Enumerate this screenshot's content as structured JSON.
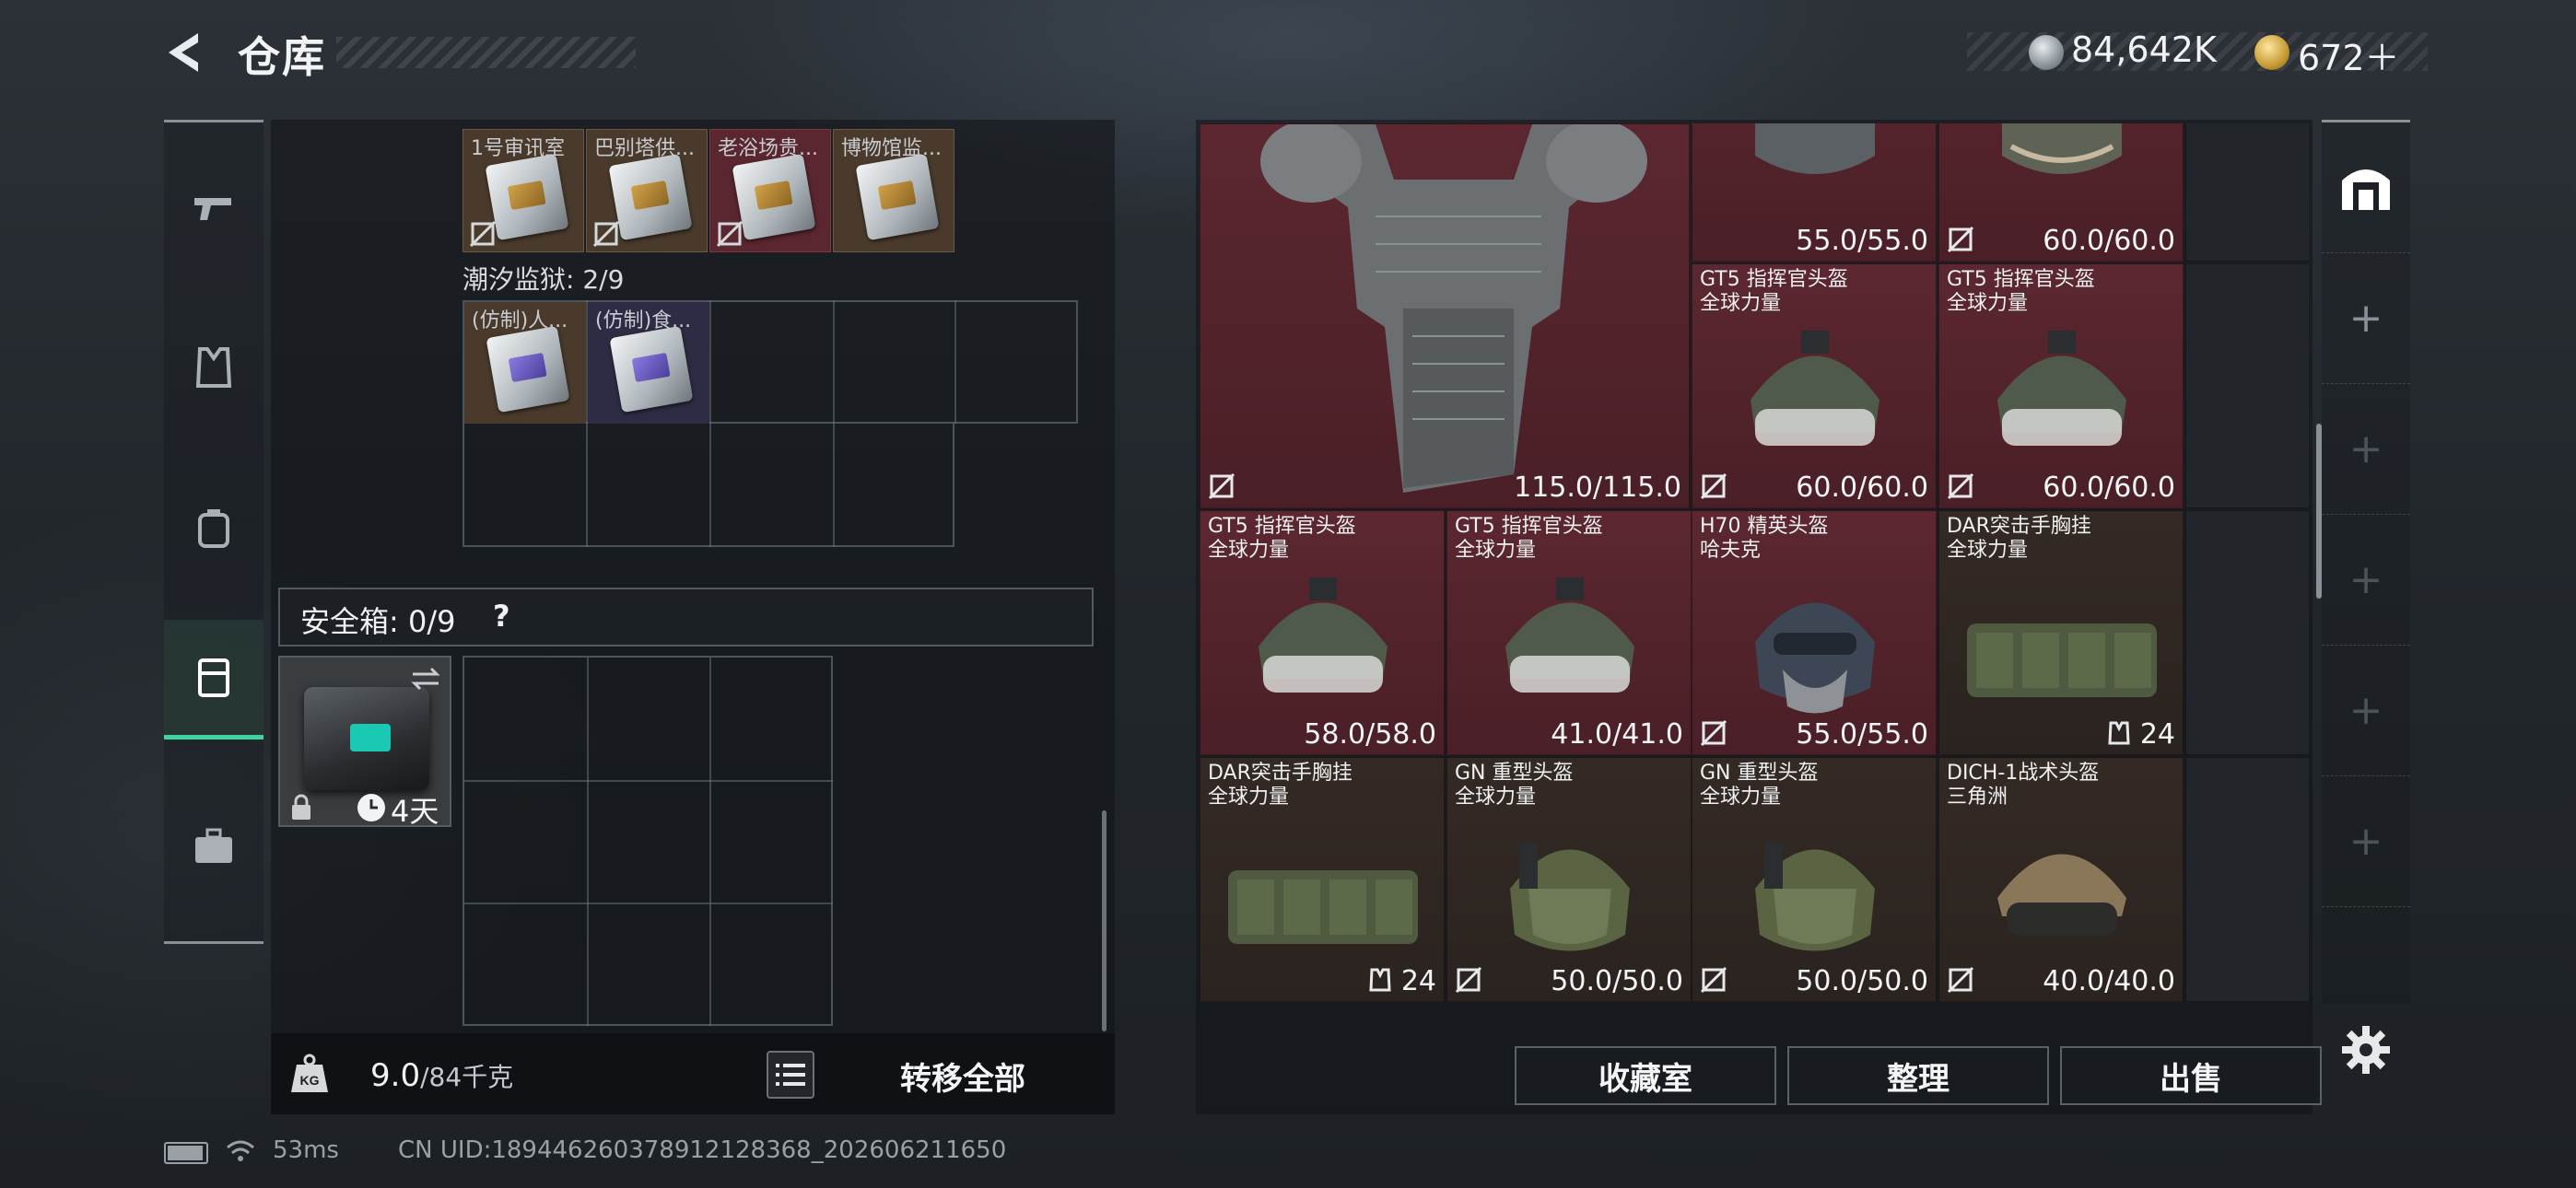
{
  "header": {
    "title": "仓库",
    "silver_amount": "84,642K",
    "gold_amount": "672＋"
  },
  "nav": {
    "items": [
      {
        "name": "weapons",
        "icon": "pistol-icon"
      },
      {
        "name": "armor",
        "icon": "vest-icon"
      },
      {
        "name": "backpack",
        "icon": "backpack-icon"
      },
      {
        "name": "containers",
        "icon": "case-icon",
        "active": true
      },
      {
        "name": "supplies",
        "icon": "toolbox-icon"
      }
    ]
  },
  "left": {
    "top_items": [
      {
        "label": "1号审讯室"
      },
      {
        "label": "巴别塔供..."
      },
      {
        "label": "老浴场贵..."
      },
      {
        "label": "博物馆监..."
      }
    ],
    "prison_label": "潮汐监狱: 2/9",
    "prison_items": [
      {
        "label": "(仿制)人..."
      },
      {
        "label": "(仿制)食..."
      }
    ],
    "safebox_label": "安全箱: 0/9",
    "safebox_help": "?",
    "safebox_timer": "4天",
    "weight_value": "9.0",
    "weight_max": "/84千克",
    "transfer_all": "转移全部"
  },
  "right": {
    "vest_durability": "115.0/115.0",
    "items": [
      {
        "name": "",
        "sub": "",
        "value": "55.0/55.0"
      },
      {
        "name": "",
        "sub": "",
        "value": "60.0/60.0"
      },
      {
        "name": "GT5 指挥官头盔",
        "sub": "全球力量",
        "value": "60.0/60.0"
      },
      {
        "name": "GT5 指挥官头盔",
        "sub": "全球力量",
        "value": "60.0/60.0"
      },
      {
        "name": "GT5 指挥官头盔",
        "sub": "全球力量",
        "value": "58.0/58.0"
      },
      {
        "name": "GT5 指挥官头盔",
        "sub": "全球力量",
        "value": "41.0/41.0"
      },
      {
        "name": "H70 精英头盔",
        "sub": "哈夫克",
        "value": "55.0/55.0"
      },
      {
        "name": "DAR突击手胸挂",
        "sub": "全球力量",
        "value": "24"
      },
      {
        "name": "DAR突击手胸挂",
        "sub": "全球力量",
        "value": "24"
      },
      {
        "name": "GN 重型头盔",
        "sub": "全球力量",
        "value": "50.0/50.0"
      },
      {
        "name": "GN 重型头盔",
        "sub": "全球力量",
        "value": "50.0/50.0"
      },
      {
        "name": "DICH-1战术头盔",
        "sub": "三角洲",
        "value": "40.0/40.0"
      }
    ],
    "buttons": {
      "collection": "收藏室",
      "sort": "整理",
      "sell": "出售"
    }
  },
  "status": {
    "ping": "53ms",
    "uid": "CN UID:18944626037891212836​8_202606211650"
  },
  "colors": {
    "accent": "#3ed3a0",
    "red_rarity": "#5c2730",
    "gold_rarity": "#342a25"
  }
}
